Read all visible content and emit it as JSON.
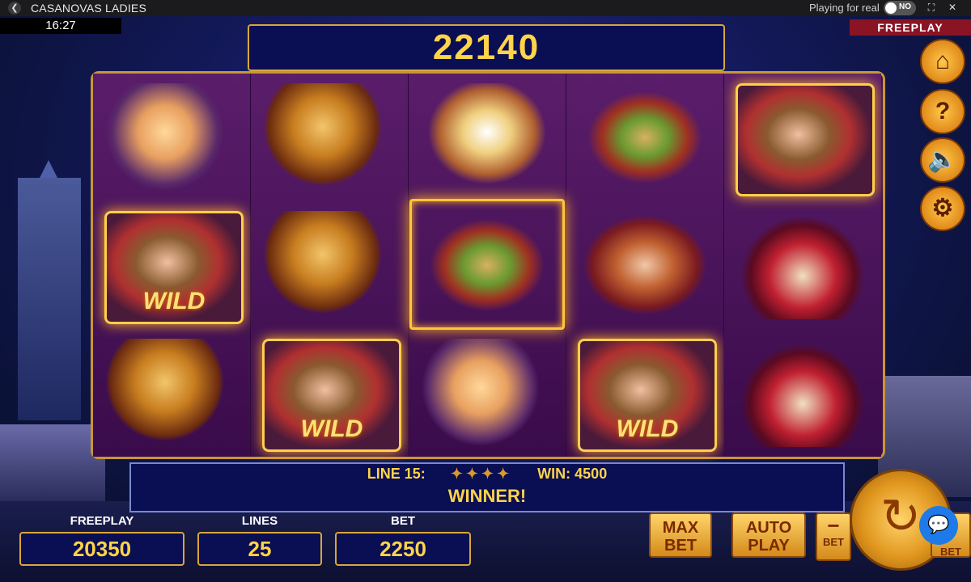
{
  "topbar": {
    "title": "CASANOVAS LADIES",
    "mode_label": "Playing for real",
    "toggle_label": "NO"
  },
  "clock": "16:27",
  "freeplay_tag": "FREEPLAY",
  "total_win": "22140",
  "reels": [
    [
      "cupid",
      "wild",
      "rose"
    ],
    [
      "rose",
      "rose",
      "wild"
    ],
    [
      "mask",
      "bird",
      "cupid"
    ],
    [
      "bird",
      "lady",
      "wild"
    ],
    [
      "man",
      "fan",
      "fan"
    ]
  ],
  "wild_label": "WILD",
  "line_info": {
    "line": "LINE 15:",
    "win": "WIN: 4500",
    "message": "WINNER!"
  },
  "stats": {
    "freeplay_label": "FREEPLAY",
    "freeplay_value": "20350",
    "lines_label": "LINES",
    "lines_value": "25",
    "bet_label": "BET",
    "bet_value": "2250"
  },
  "buttons": {
    "max_top": "MAX",
    "max_bottom": "BET",
    "auto_top": "AUTO",
    "auto_bottom": "PLAY",
    "minus_sign": "−",
    "minus_label": "BET",
    "plus_label": "BET"
  },
  "icons": {
    "home": "home-icon",
    "help": "help-icon",
    "sound": "sound-off-icon",
    "settings": "gear-icon",
    "spin": "spin-icon",
    "chat": "chat-icon"
  }
}
